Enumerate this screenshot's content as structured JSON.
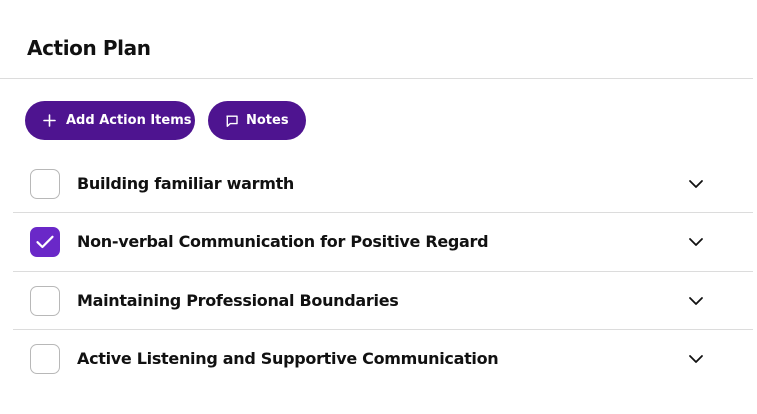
{
  "header": {
    "title": "Action Plan"
  },
  "toolbar": {
    "add_label": "Add Action Items",
    "add_icon": "plus-icon",
    "notes_label": "Notes",
    "notes_icon": "speech-bubble-icon"
  },
  "colors": {
    "primary_button": "#4e1490",
    "checkbox_checked": "#6a28c8",
    "divider": "#dcdcdc"
  },
  "action_items": [
    {
      "label": "Building familiar warmth",
      "checked": false
    },
    {
      "label": "Non-verbal Communication for Positive Regard",
      "checked": true
    },
    {
      "label": "Maintaining Professional Boundaries",
      "checked": false
    },
    {
      "label": "Active Listening and Supportive Communication",
      "checked": false
    }
  ]
}
